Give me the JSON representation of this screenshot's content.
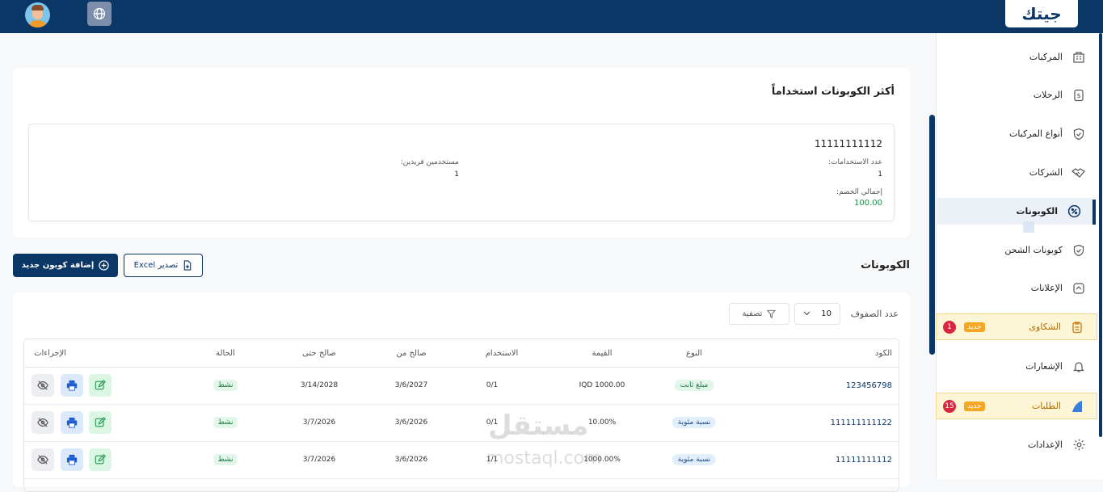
{
  "brand": {
    "logo_text": "جيتك"
  },
  "sidebar": {
    "items": [
      {
        "label": "المركبات",
        "icon": "building-icon"
      },
      {
        "label": "الرحلات",
        "icon": "receipt-dollar-icon"
      },
      {
        "label": "أنواع المركبات",
        "icon": "shield-check-icon"
      },
      {
        "label": "الشركات",
        "icon": "handshake-icon"
      },
      {
        "label": "الكوبونات",
        "icon": "discount-badge-icon"
      },
      {
        "label": "كوبونات الشحن",
        "icon": "shield-check-icon"
      },
      {
        "label": "الإعلانات",
        "icon": "megaphone-icon"
      },
      {
        "label": "الشكاوى",
        "icon": "clipboard-icon",
        "badge_new": "جديد",
        "count": "1"
      },
      {
        "label": "الإشعارات",
        "icon": "bell-icon"
      },
      {
        "label": "الطلبات",
        "icon": "wedge-icon",
        "badge_new": "جديد",
        "count": "15"
      },
      {
        "label": "الإعدادات",
        "icon": "gear-icon"
      }
    ]
  },
  "top_coupons": {
    "title": "أكثر الكوبونات استخداماً",
    "code": "11111111112",
    "uses_label": "عدد الاستخدامات:",
    "uses_value": "1",
    "unique_users_label": "مستخدمين فريدين:",
    "unique_users_value": "1",
    "total_discount_label": "إجمالي الخصم:",
    "total_discount_value": "100.00"
  },
  "coupons_section": {
    "title": "الكوبونات",
    "add_button": "إضافة كوبون جديد",
    "export_button": "تصدير Excel"
  },
  "table_controls": {
    "rows_label": "عدد الصفوف",
    "rows_value": "10",
    "filter_label": "تصفية"
  },
  "table": {
    "headers": {
      "code": "الكود",
      "type": "النوع",
      "value": "القيمة",
      "usage": "الاستخدام",
      "valid_from": "صالح من",
      "valid_to": "صالح حتى",
      "status": "الحالة",
      "actions": "الإجراءات"
    },
    "rows": [
      {
        "code": "123456798",
        "type": "مبلغ ثابت",
        "value": "IQD 1000.00",
        "usage": "0/1",
        "valid_from": "3/6/2027",
        "valid_to": "3/14/2028",
        "status": "نشط"
      },
      {
        "code": "111111111122",
        "type": "نسبة مئوية",
        "value": "10.00%",
        "usage": "0/1",
        "valid_from": "3/6/2026",
        "valid_to": "3/7/2026",
        "status": "نشط"
      },
      {
        "code": "11111111112",
        "type": "نسبة مئوية",
        "value": "1000.00%",
        "usage": "1/1",
        "valid_from": "3/6/2026",
        "valid_to": "3/7/2026",
        "status": "نشط"
      }
    ]
  },
  "watermark": {
    "arabic": "مستقل",
    "latin": "mostaql.com"
  }
}
